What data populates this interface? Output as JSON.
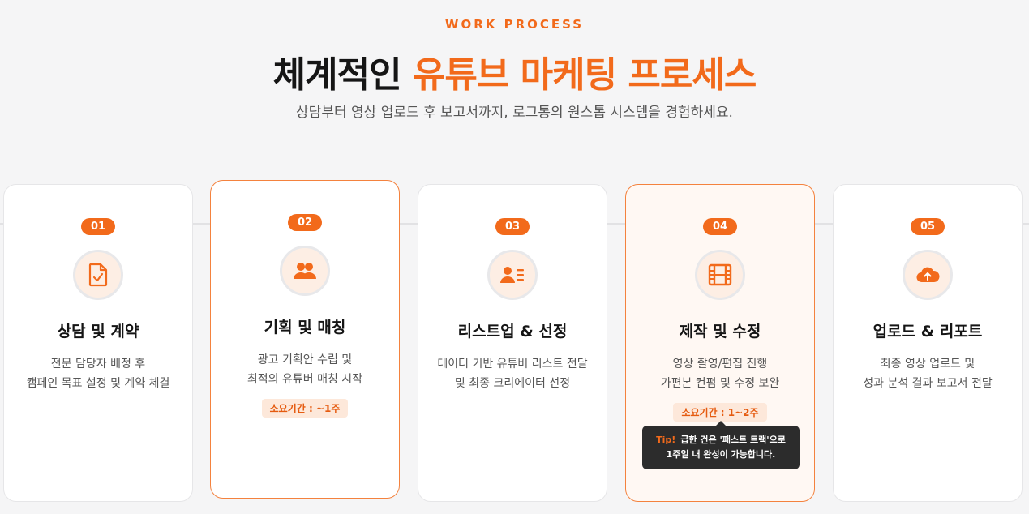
{
  "header": {
    "eyebrow": "WORK PROCESS",
    "title_main": "체계적인",
    "title_accent": "유튜브 마케팅 프로세스",
    "subtitle": "상담부터 영상 업로드 후 보고서까지, 로그통의 원스톱 시스템을 경험하세요."
  },
  "colors": {
    "accent": "#f26a1b",
    "badge_bg": "#f26a1b",
    "tip_bg": "#2c2c2c"
  },
  "steps": [
    {
      "num": "01",
      "icon": "document-check-icon",
      "title": "상담 및 계약",
      "desc1": "전문 담당자 배정 후",
      "desc2": "캠페인 목표 설정 및 계약 체결"
    },
    {
      "num": "02",
      "icon": "users-icon",
      "title": "기획 및 매칭",
      "desc1": "광고 기획안 수립 및",
      "desc2": "최적의 유튜버 매칭 시작",
      "period": "소요기간 : ~1주"
    },
    {
      "num": "03",
      "icon": "contact-list-icon",
      "title": "리스트업 & 선정",
      "desc1": "데이터 기반 유튜버 리스트 전달",
      "desc2": "및 최종 크리에이터 선정"
    },
    {
      "num": "04",
      "icon": "film-icon",
      "title": "제작 및 수정",
      "desc1": "영상 촬영/편집 진행",
      "desc2": "가편본 컨펌 및 수정 보완",
      "period": "소요기간 : 1~2주"
    },
    {
      "num": "05",
      "icon": "cloud-upload-icon",
      "title": "업로드 & 리포트",
      "desc1": "최종 영상 업로드 및",
      "desc2": "성과 분석 결과 보고서 전달"
    }
  ],
  "tip": {
    "label": "Tip!",
    "line1": "급한 건은 '패스트 트랙'으로",
    "line2": "1주일 내 완성이 가능합니다."
  }
}
